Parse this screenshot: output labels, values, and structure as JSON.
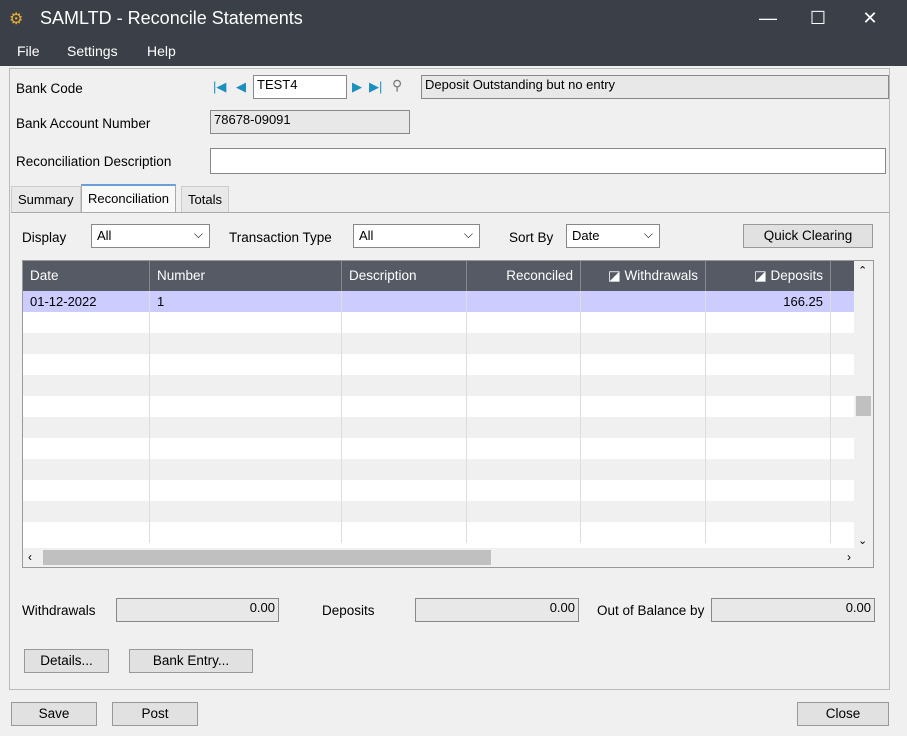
{
  "window": {
    "title": "SAMLTD - Reconcile Statements"
  },
  "menu": [
    {
      "label": "File"
    },
    {
      "label": "Settings"
    },
    {
      "label": "Help"
    }
  ],
  "header": {
    "bank_code_label": "Bank Code",
    "bank_code": "TEST4",
    "bank_description": "Deposit Outstanding but no entry",
    "account_number_label": "Bank Account Number",
    "account_number": "78678-09091",
    "recon_desc_label": "Reconciliation Description",
    "recon_desc": ""
  },
  "tabs": [
    {
      "label": "Summary"
    },
    {
      "label": "Reconciliation",
      "active": true
    },
    {
      "label": "Totals"
    }
  ],
  "filters": {
    "display_label": "Display",
    "display": "All",
    "type_label": "Transaction Type",
    "type": "All",
    "sort_label": "Sort By",
    "sort": "Date",
    "quick_clearing": "Quick Clearing"
  },
  "grid": {
    "columns": [
      "Date",
      "Number",
      "Description",
      "Reconciled",
      "Withdrawals",
      "Deposits"
    ],
    "rows": [
      {
        "date": "01-12-2022",
        "number": "1",
        "description": "",
        "reconciled": "",
        "withdrawals": "",
        "deposits": "166.25"
      }
    ]
  },
  "totals": {
    "withdrawals_label": "Withdrawals",
    "withdrawals": "0.00",
    "deposits_label": "Deposits",
    "deposits": "0.00",
    "oob_label": "Out of Balance by",
    "oob": "0.00"
  },
  "buttons": {
    "details": "Details...",
    "bank_entry": "Bank Entry...",
    "save": "Save",
    "post": "Post",
    "close": "Close"
  },
  "colors": {
    "titlebar": "#3b3f48",
    "grid_header": "#555a64",
    "selected_row": "#ccccff",
    "nav_accent": "#1b8fbf"
  }
}
